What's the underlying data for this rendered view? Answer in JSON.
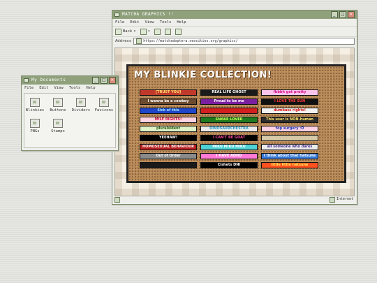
{
  "browser": {
    "title": "MATCHA GRAPHICS !!",
    "menu": [
      "File",
      "Edit",
      "View",
      "Tools",
      "Help"
    ],
    "toolbar": {
      "back_label": "Back",
      "back_arrow": "▾",
      "forward_arrow": "▾"
    },
    "address_label": "Address",
    "address_value": "https://matchadoptera.neocities.org/graphics/",
    "status_right": "Internet"
  },
  "page": {
    "heading": "MY BLINKIE COLLECTION!",
    "blinkies": [
      {
        "text": "[TRUST YOU]",
        "bg": "#c0392b",
        "fg": "#ffe36e"
      },
      {
        "text": "REAL LIFE GHOST",
        "bg": "#1a1a1a",
        "fg": "#ffffff"
      },
      {
        "text": "fbbbh got pretty",
        "bg": "#ffc4ec",
        "fg": "#d0108e"
      },
      {
        "text": "I wanna be a cowboy",
        "bg": "#6b4a2e",
        "fg": "#ffffff"
      },
      {
        "text": "Proud to be me",
        "bg": "#7a1fa0",
        "fg": "#ffffff"
      },
      {
        "text": "I LOVE THE SUN",
        "bg": "#111111",
        "fg": "#ff3a3a"
      },
      {
        "text": "Sick of this",
        "bg": "#1f46c8",
        "fg": "#9ee8ff"
      },
      {
        "text": "",
        "bg": "#d11e1e",
        "fg": "#000000"
      },
      {
        "text": "dumbass rights!",
        "bg": "#f2f2f2",
        "fg": "#d01a1a"
      },
      {
        "text": "MILF RIGHTS!",
        "bg": "#ffd4e0",
        "fg": "#d0103a"
      },
      {
        "text": "SNAKE LOVER",
        "bg": "#1e7a1e",
        "fg": "#c8ff5a"
      },
      {
        "text": "This user is NON-human",
        "bg": "#2c2c2c",
        "fg": "#ffe86a"
      },
      {
        "text": "pluralsident",
        "bg": "#dff2c8",
        "fg": "#2c5e1a"
      },
      {
        "text": "DINOSAURCHESTRA",
        "bg": "#ececec",
        "fg": "#2aa0c8"
      },
      {
        "text": "top surgery :D",
        "bg": "#ffd2e4",
        "fg": "#2040c0"
      },
      {
        "text": "YEEHAW!",
        "bg": "#000000",
        "fg": "#ffffff"
      },
      {
        "text": "I CAN'T BE GOAT",
        "bg": "#000000",
        "fg": "#ff4aa0"
      },
      {
        "text": "",
        "bg": "#d6c9a8",
        "fg": "#5a2a8a"
      },
      {
        "text": "HOMOSEXUAL BEHAVIOUR",
        "bg": "#b82020",
        "fg": "#ffffff"
      },
      {
        "text": "MIKU MIKU MIKU",
        "bg": "#4fd2d6",
        "fg": "#ffffff"
      },
      {
        "text": "all someone who dares",
        "bg": "#ececec",
        "fg": "#4a2a8a"
      },
      {
        "text": "Out of Order",
        "bg": "#8a8a8a",
        "fg": "#ffffff"
      },
      {
        "text": "I HAVE ADHD",
        "bg": "#ff7ad6",
        "fg": "#ffffff"
      },
      {
        "text": "I think about that hatsune",
        "bg": "#3a7ad6",
        "fg": "#ffffff"
      },
      {
        "text": "",
        "bg": "#1a1a1a",
        "fg": "#ffcc22"
      },
      {
        "text": "Cishets DNI",
        "bg": "#000000",
        "fg": "#ffffff"
      },
      {
        "text": "little little hatsune",
        "bg": "#ff5020",
        "fg": "#ffee55"
      }
    ]
  },
  "explorer": {
    "title": "My Documents",
    "menu": [
      "File",
      "Edit",
      "View",
      "Tools",
      "Help"
    ],
    "items": [
      "Blinkies",
      "Buttons",
      "Dividers",
      "Favicons",
      "PNGs",
      "Stamps"
    ]
  },
  "colors": {
    "accent": "#8ea17b",
    "cork": "#b88a58"
  }
}
